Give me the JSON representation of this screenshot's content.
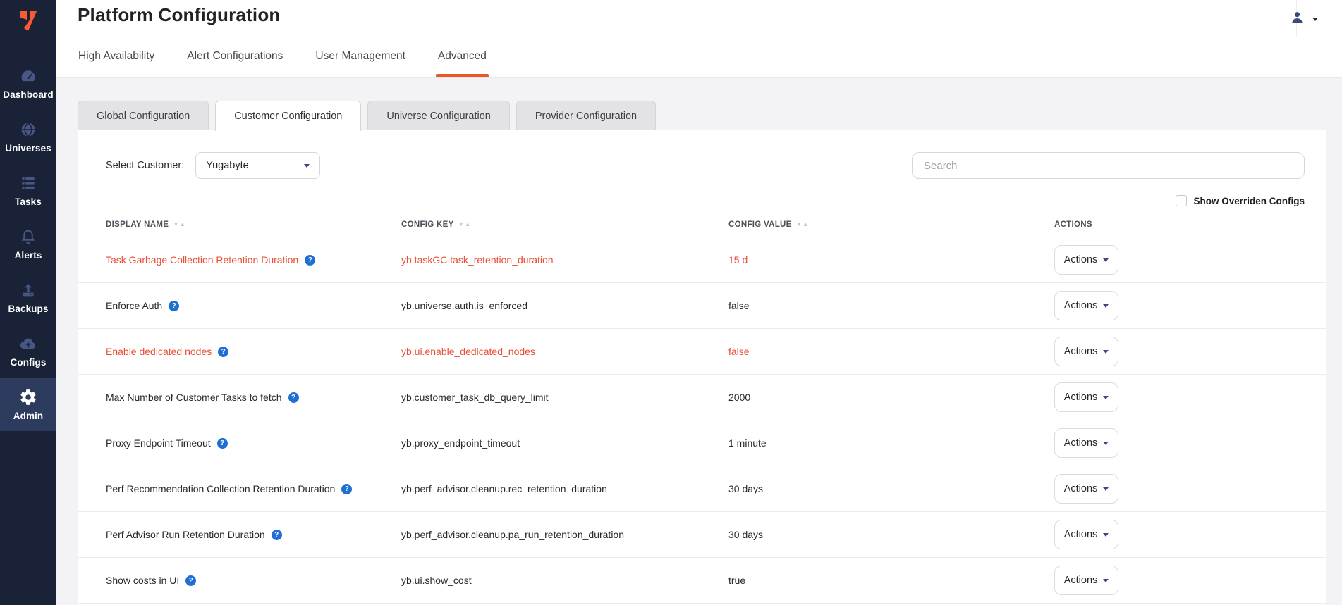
{
  "app": {
    "title": "Platform Configuration"
  },
  "colors": {
    "sidebar_bg": "#1a2238",
    "sidebar_active_bg": "#2d3b5e",
    "accent_orange": "#ec5628",
    "overridden_red": "#e84f35",
    "help_blue": "#1f6ed3",
    "caret_navy": "#3a4784"
  },
  "sidebar": {
    "items": [
      {
        "icon": "dashboard",
        "label": "Dashboard",
        "active": false
      },
      {
        "icon": "universes",
        "label": "Universes",
        "active": false
      },
      {
        "icon": "tasks",
        "label": "Tasks",
        "active": false
      },
      {
        "icon": "alerts",
        "label": "Alerts",
        "active": false
      },
      {
        "icon": "backups",
        "label": "Backups",
        "active": false
      },
      {
        "icon": "configs",
        "label": "Configs",
        "active": false
      },
      {
        "icon": "admin",
        "label": "Admin",
        "active": true
      }
    ]
  },
  "header": {
    "tabs": [
      {
        "label": "High Availability",
        "active": false
      },
      {
        "label": "Alert Configurations",
        "active": false
      },
      {
        "label": "User Management",
        "active": false
      },
      {
        "label": "Advanced",
        "active": true
      }
    ]
  },
  "subtabs": [
    {
      "label": "Global Configuration",
      "active": false
    },
    {
      "label": "Customer Configuration",
      "active": true
    },
    {
      "label": "Universe Configuration",
      "active": false
    },
    {
      "label": "Provider Configuration",
      "active": false
    }
  ],
  "toolbar": {
    "select_customer_label": "Select Customer:",
    "customer_value": "Yugabyte",
    "search_placeholder": "Search",
    "show_overridden_label": "Show Overriden Configs",
    "show_overridden_checked": false
  },
  "table": {
    "columns": [
      {
        "label": "DISPLAY NAME",
        "sortable": true
      },
      {
        "label": "CONFIG KEY",
        "sortable": true
      },
      {
        "label": "CONFIG VALUE",
        "sortable": true
      },
      {
        "label": "ACTIONS",
        "sortable": false
      }
    ],
    "actions_label": "Actions",
    "rows": [
      {
        "display_name": "Task Garbage Collection Retention Duration",
        "config_key": "yb.taskGC.task_retention_duration",
        "config_value": "15 d",
        "overridden": true
      },
      {
        "display_name": "Enforce Auth",
        "config_key": "yb.universe.auth.is_enforced",
        "config_value": "false",
        "overridden": false
      },
      {
        "display_name": "Enable dedicated nodes",
        "config_key": "yb.ui.enable_dedicated_nodes",
        "config_value": "false",
        "overridden": true
      },
      {
        "display_name": "Max Number of Customer Tasks to fetch",
        "config_key": "yb.customer_task_db_query_limit",
        "config_value": "2000",
        "overridden": false
      },
      {
        "display_name": "Proxy Endpoint Timeout",
        "config_key": "yb.proxy_endpoint_timeout",
        "config_value": "1 minute",
        "overridden": false
      },
      {
        "display_name": "Perf Recommendation Collection Retention Duration",
        "config_key": "yb.perf_advisor.cleanup.rec_retention_duration",
        "config_value": "30 days",
        "overridden": false
      },
      {
        "display_name": "Perf Advisor Run Retention Duration",
        "config_key": "yb.perf_advisor.cleanup.pa_run_retention_duration",
        "config_value": "30 days",
        "overridden": false
      },
      {
        "display_name": "Show costs in UI",
        "config_key": "yb.ui.show_cost",
        "config_value": "true",
        "overridden": false
      }
    ]
  }
}
